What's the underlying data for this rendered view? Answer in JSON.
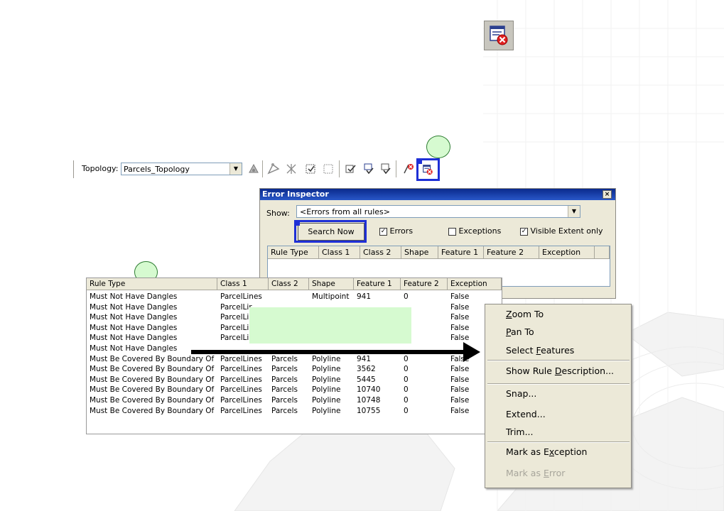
{
  "toolbar": {
    "label": "Topology:",
    "combo_value": "Parcels_Topology"
  },
  "inspector": {
    "title": "Error Inspector",
    "close_glyph": "×",
    "show_label": "Show:",
    "show_value": "<Errors from all rules>",
    "search_button": "Search Now",
    "errors_label": "Errors",
    "exceptions_label": "Exceptions",
    "visible_extent_label": "Visible Extent only",
    "errors_checked": true,
    "exceptions_checked": false,
    "visible_extent_checked": true,
    "columns": [
      "Rule Type",
      "Class 1",
      "Class 2",
      "Shape",
      "Feature 1",
      "Feature 2",
      "Exception"
    ]
  },
  "results": {
    "columns": [
      "Rule Type",
      "Class 1",
      "Class 2",
      "Shape",
      "Feature 1",
      "Feature 2",
      "Exception"
    ],
    "rows": [
      [
        "Must Not Have Dangles",
        "ParcelLines",
        "",
        "Multipoint",
        "941",
        "0",
        "False"
      ],
      [
        "Must Not Have Dangles",
        "ParcelLir",
        "",
        "",
        "",
        "",
        "False"
      ],
      [
        "Must Not Have Dangles",
        "ParcelLir",
        "",
        "",
        "",
        "",
        "False"
      ],
      [
        "Must Not Have Dangles",
        "ParcelLir",
        "",
        "",
        "",
        "",
        "False"
      ],
      [
        "Must Not Have Dangles",
        "ParcelLir",
        "",
        "",
        "",
        "",
        "False"
      ],
      [
        "Must Not Have Dangles",
        "",
        "",
        "",
        "",
        "",
        ""
      ],
      [
        "Must Be Covered By Boundary Of",
        "ParcelLines",
        "Parcels",
        "Polyline",
        "941",
        "0",
        "False"
      ],
      [
        "Must Be Covered By Boundary Of",
        "ParcelLines",
        "Parcels",
        "Polyline",
        "3562",
        "0",
        "False"
      ],
      [
        "Must Be Covered By Boundary Of",
        "ParcelLines",
        "Parcels",
        "Polyline",
        "5445",
        "0",
        "False"
      ],
      [
        "Must Be Covered By Boundary Of",
        "ParcelLines",
        "Parcels",
        "Polyline",
        "10740",
        "0",
        "False"
      ],
      [
        "Must Be Covered By Boundary Of",
        "ParcelLines",
        "Parcels",
        "Polyline",
        "10748",
        "0",
        "False"
      ],
      [
        "Must Be Covered By Boundary Of",
        "ParcelLines",
        "Parcels",
        "Polyline",
        "10755",
        "0",
        "False"
      ]
    ]
  },
  "context_menu": {
    "zoom_to_mnemonic": "Z",
    "zoom_to_rest": "oom To",
    "pan_to_mnemonic": "P",
    "pan_to_rest": "an To",
    "select_pre": "Select ",
    "select_mnemonic": "F",
    "select_rest": "eatures",
    "show_rule_pre": "Show Rule ",
    "show_rule_mnemonic": "D",
    "show_rule_rest": "escription...",
    "snap": "Snap...",
    "extend": "Extend...",
    "trim": "Trim...",
    "mark_exc_pre": "Mark as E",
    "mark_exc_mnemonic": "x",
    "mark_exc_rest": "ception",
    "mark_err_pre": "Mark as ",
    "mark_err_mnemonic": "E",
    "mark_err_rest": "rror"
  },
  "colors": {
    "highlight": "#1e2fd6",
    "callout_fill": "#d6fad0",
    "callout_border": "#2e7d32",
    "title_bar": "#0a2a8c"
  },
  "icons": [
    "error-inspector-icon",
    "topology-edit-icon",
    "fix-error-icon",
    "validate-icon",
    "dropdown-arrow-icon",
    "close-icon"
  ]
}
